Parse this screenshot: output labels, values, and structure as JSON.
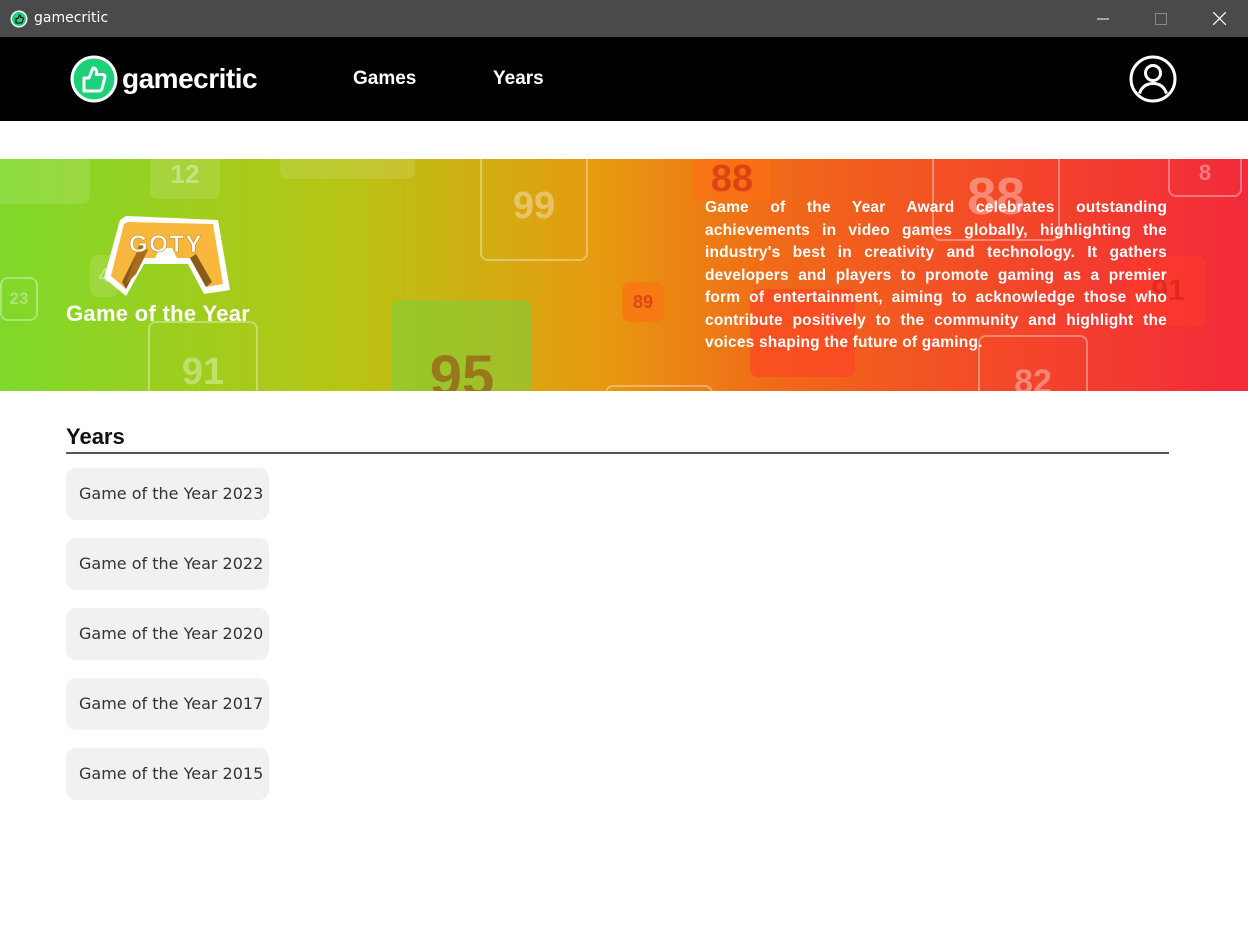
{
  "window": {
    "title": "gamecritic",
    "icon": "gamecritic-app-icon",
    "controls": [
      "minimize-icon",
      "maximize-icon",
      "close-icon"
    ]
  },
  "nav": {
    "logo_text": "gamecritic",
    "logo_icon": "thumbs-up-icon",
    "links": [
      "Games",
      "Years"
    ],
    "user_icon": "user-account-icon"
  },
  "banner": {
    "badge_text": "GOTY",
    "title": "Game of the Year",
    "description": "Game of the Year Award celebrates outstanding achievements in video games globally, highlighting the industry's best in creativity and technology. It gathers developers and players to promote gaming as a premier form of entertainment, aiming to acknowledge those who contribute positively to the community and highlight the voices shaping the future of gaming.",
    "background_scores": [
      "12",
      "99",
      "88",
      "88",
      "8",
      "23",
      "89",
      "91",
      "95",
      "91",
      "82",
      "4"
    ],
    "colors": {
      "gradient_start": "#7fd92a",
      "gradient_mid": "#e79a10",
      "gradient_end": "#f22a3a"
    }
  },
  "years_section": {
    "heading": "Years",
    "items": [
      "Game of the Year 2023",
      "Game of the Year 2022",
      "Game of the Year 2020",
      "Game of the Year 2017",
      "Game of the Year 2015"
    ]
  },
  "colors": {
    "brand_green": "#1ed07a",
    "navbar": "#000000",
    "titlebar": "#4a4a4a"
  }
}
